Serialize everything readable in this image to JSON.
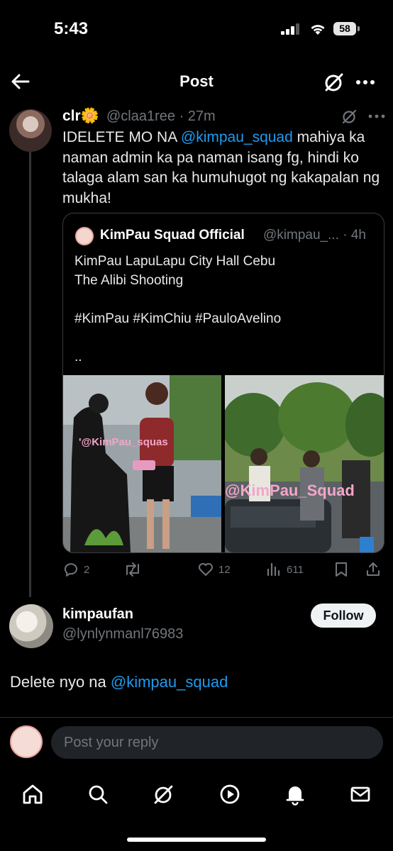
{
  "status": {
    "time": "5:43",
    "battery": "58"
  },
  "header": {
    "title": "Post"
  },
  "tweet": {
    "name": "clr",
    "emoji": "🌼",
    "handle_time": "@claa1ree · 27m",
    "text_pre": "IDELETE MO NA ",
    "mention": "@kimpau_squad",
    "text_post": " mahiya ka naman admin ka pa naman isang fg, hindi ko talaga alam san ka humuhugot ng kakapalan ng mukha!",
    "quote": {
      "name": "KimPau Squad Official",
      "handle_time": "@kimpau_... · 4h",
      "text": "KimPau LapuLapu City Hall Cebu\nThe Alibi Shooting\n\n#KimPau #KimChiu #PauloAvelino\n\n..",
      "watermark1": "'@KimPau_squas",
      "watermark2": "@KimPau_Squad"
    },
    "actions": {
      "replies": "2",
      "likes": "12",
      "views": "611"
    }
  },
  "reply": {
    "name": "kimpaufan",
    "handle": "@lynlynmanl76983",
    "follow_label": "Follow",
    "text_pre": "Delete nyo na ",
    "mention": "@kimpau_squad"
  },
  "composer": {
    "placeholder": "Post your reply"
  },
  "nav": [
    "home-icon",
    "search-icon",
    "grok-icon",
    "video-icon",
    "notifications-icon",
    "messages-icon"
  ],
  "colors": {
    "link": "#1d9bf0",
    "muted": "#71767b",
    "background": "#000000"
  }
}
